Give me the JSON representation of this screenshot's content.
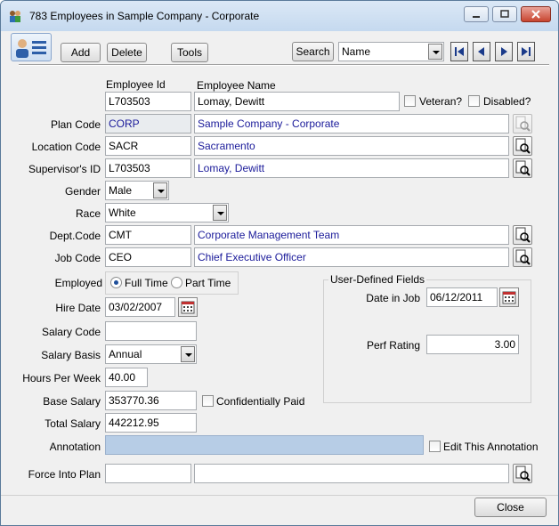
{
  "window": {
    "title": "783 Employees in Sample Company - Corporate"
  },
  "toolbar": {
    "add": "Add",
    "delete": "Delete",
    "tools": "Tools",
    "search": "Search",
    "search_field": "Name"
  },
  "labels": {
    "employee_id": "Employee Id",
    "employee_name": "Employee Name",
    "veteran": "Veteran?",
    "disabled": "Disabled?",
    "plan_code": "Plan Code",
    "location_code": "Location Code",
    "supervisor_id": "Supervisor's ID",
    "gender": "Gender",
    "race": "Race",
    "dept_code": "Dept.Code",
    "job_code": "Job Code",
    "employed": "Employed",
    "full_time": "Full Time",
    "part_time": "Part Time",
    "hire_date": "Hire Date",
    "salary_code": "Salary Code",
    "salary_basis": "Salary Basis",
    "hours_per_week": "Hours Per Week",
    "base_salary": "Base Salary",
    "confidentially_paid": "Confidentially Paid",
    "total_salary": "Total Salary",
    "annotation": "Annotation",
    "edit_annotation": "Edit This Annotation",
    "force_into_plan": "Force Into Plan",
    "user_defined_fields": "User-Defined Fields",
    "date_in_job": "Date in Job",
    "perf_rating": "Perf Rating"
  },
  "values": {
    "employee_id": "L703503",
    "employee_name": "Lomay, Dewitt",
    "plan_code": "CORP",
    "plan_name": "Sample Company - Corporate",
    "location_code": "SACR",
    "location_name": "Sacramento",
    "supervisor_id": "L703503",
    "supervisor_name": "Lomay, Dewitt",
    "gender": "Male",
    "race": "White",
    "dept_code": "CMT",
    "dept_name": "Corporate Management Team",
    "job_code": "CEO",
    "job_name": "Chief Executive Officer",
    "hire_date": "03/02/2007",
    "salary_code": "",
    "salary_basis": "Annual",
    "hours_per_week": "40.00",
    "base_salary": "353770.36",
    "total_salary": "442212.95",
    "annotation": "",
    "force_plan_code": "",
    "force_plan_name": "",
    "date_in_job": "06/12/2011",
    "perf_rating": "3.00"
  },
  "footer": {
    "close": "Close"
  }
}
